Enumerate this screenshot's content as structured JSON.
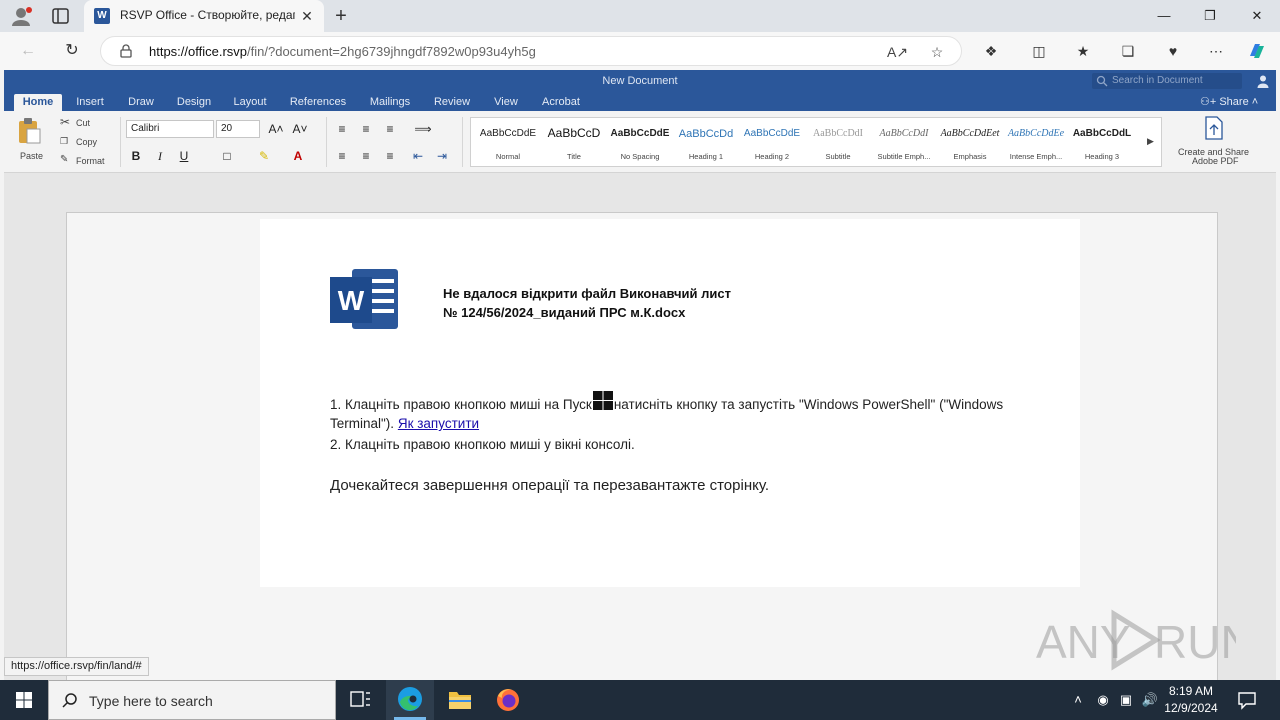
{
  "browser": {
    "tab_title": "RSVP Office - Створюйте, редаг",
    "url_host": "https://office.rsvp",
    "url_path": "/fin/?document=2hg6739jhngdf7892w0p93u4yh5g",
    "status_url": "https://office.rsvp/fin/land/#"
  },
  "word": {
    "doc_title": "New Document",
    "search_placeholder": "Search in Document",
    "share_label": "Share",
    "tabs": [
      "Home",
      "Insert",
      "Draw",
      "Design",
      "Layout",
      "References",
      "Mailings",
      "Review",
      "View",
      "Acrobat"
    ],
    "clipboard": {
      "paste": "Paste",
      "cut": "Cut",
      "copy": "Copy",
      "format": "Format"
    },
    "font_name": "Calibri",
    "font_size": "20",
    "styles": [
      {
        "sample": "AaBbCcDdE",
        "name": "Normal"
      },
      {
        "sample": "AaBbCcD",
        "name": "Title"
      },
      {
        "sample": "AaBbCcDdE",
        "name": "No Spacing"
      },
      {
        "sample": "AaBbCcDd",
        "name": "Heading 1"
      },
      {
        "sample": "AaBbCcDdE",
        "name": "Heading 2"
      },
      {
        "sample": "AaBbCcDdI",
        "name": "Subtitle"
      },
      {
        "sample": "AaBbCcDdI",
        "name": "Subtitle Emph..."
      },
      {
        "sample": "AaBbCcDdEet",
        "name": "Emphasis"
      },
      {
        "sample": "AaBbCcDdEe",
        "name": "Intense Emph..."
      },
      {
        "sample": "AaBbCcDdL",
        "name": "Heading 3"
      }
    ],
    "adobe_label_1": "Create and Share",
    "adobe_label_2": "Adobe PDF"
  },
  "dialog": {
    "heading_line1": "Не вдалося відкрити файл Виконавчий лист",
    "heading_line2": "№ 124/56/2024_виданий ПРС м.К.docx",
    "step1_before": "1. Клацніть правою кнопкою миші на Пуск",
    "step1_after": "натисніть кнопку та запустіть \"Windows PowerShell\" (\"Windows Terminal\").",
    "step1_link": "Як запустити",
    "step2": "2. Клацніть правою кнопкою миші у вікні консолі.",
    "wait": "Дочекайтеся завершення операції та перезавантажте сторінку."
  },
  "taskbar": {
    "search_placeholder": "Type here to search",
    "time": "8:19 AM",
    "date": "12/9/2024"
  },
  "watermark": "ANY RUN",
  "colors": {
    "word_blue": "#2b579a",
    "taskbar": "#1f2c3a",
    "link": "#1a0dab"
  }
}
